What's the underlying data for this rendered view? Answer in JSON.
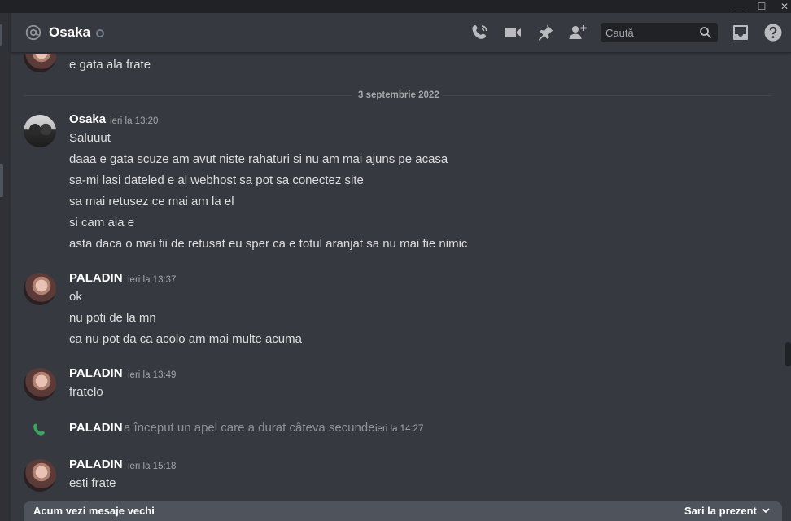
{
  "window": {
    "minimize_glyph": "—",
    "maximize_glyph": "☐",
    "close_glyph": "✕"
  },
  "header": {
    "channel_name": "Osaka",
    "search_placeholder": "Caută",
    "icons": [
      "at-icon",
      "phone-call-icon",
      "video-call-icon",
      "pin-icon",
      "add-friend-icon",
      "search-icon",
      "inbox-icon",
      "help-icon"
    ]
  },
  "messages": {
    "top_line": "e gata ala frate",
    "date_divider": "3 septembrie 2022",
    "groups": [
      {
        "author": "Osaka",
        "time": "ieri la 13:20",
        "lines": [
          "Saluuut",
          "daaa e gata scuze am avut niste rahaturi si nu am mai ajuns pe acasa",
          "sa-mi lasi dateled e al webhost sa pot sa conectez site",
          "sa mai retusez ce mai am la el",
          "si cam aia e",
          "asta daca o mai fii de retusat eu sper ca e totul aranjat sa nu mai fie nimic"
        ]
      },
      {
        "author": "PALADIN",
        "time": "ieri la 13:37",
        "lines": [
          "ok",
          "nu poti de la mn",
          "ca nu pot da ca acolo am mai multe acuma"
        ]
      },
      {
        "author": "PALADIN",
        "time": "ieri la 13:49",
        "lines": [
          "fratelo"
        ]
      },
      {
        "author": "PALADIN",
        "time": "ieri la 15:18",
        "lines": [
          "esti frate"
        ]
      }
    ],
    "call": {
      "author": "PALADIN",
      "text": "a început un apel care a durat câteva secunde.",
      "time": "ieri la 14:27"
    }
  },
  "bottom_bar": {
    "old_messages": "Acum vezi mesaje vechi",
    "jump_label": "Sari la prezent"
  },
  "colors": {
    "background": "#36393f",
    "call_green": "#3ba55d",
    "text": "#dcddde",
    "muted": "#a3a6aa"
  }
}
